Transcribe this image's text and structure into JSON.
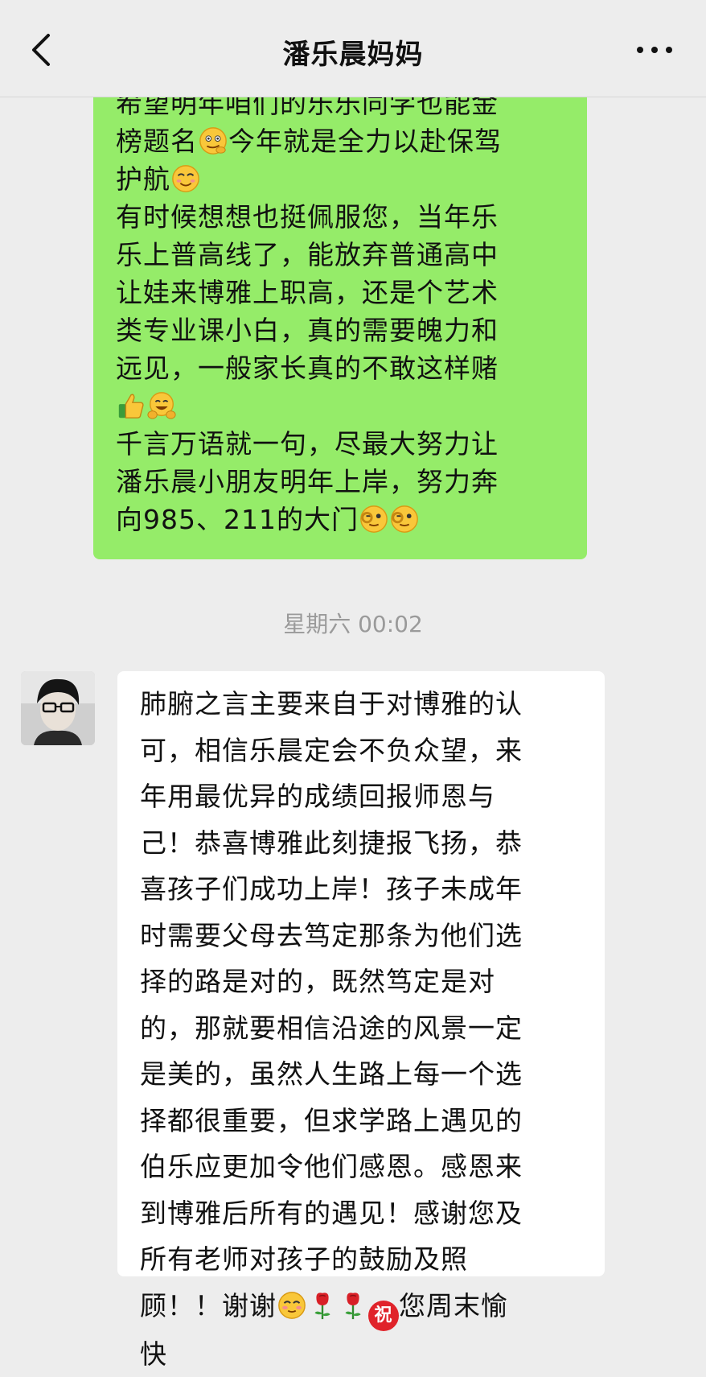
{
  "header": {
    "title": "潘乐晨妈妈",
    "back_icon": "chevron-left-icon",
    "more_icon": "ellipsis-icon"
  },
  "colors": {
    "background": "#ededed",
    "outgoing_bubble": "#95ec69",
    "incoming_bubble": "#ffffff",
    "timestamp_text": "#9a9a9a"
  },
  "outgoing_message": {
    "line1": "希望明年咱们的乐乐同学也能金",
    "line2a": "榜题名",
    "line2b": "今年就是全力以赴保驾",
    "line3": "护航",
    "line4": "有时候想想也挺佩服您，当年乐",
    "line5": "乐上普高线了，能放弃普通高中",
    "line6": "让娃来博雅上职高，还是个艺术",
    "line7": "类专业课小白，真的需要魄力和",
    "line8": "远见，一般家长真的不敢这样赌",
    "line10": "千言万语就一句，尽最大努力让",
    "line11": "潘乐晨小朋友明年上岸，努力奔",
    "line12": "向985、211的大门",
    "emojis": [
      "smirk-hand-chin",
      "smiling",
      "thumbs-up",
      "grinning-hands",
      "wink-ok",
      "wink-ok"
    ]
  },
  "timestamp": "星期六 00:02",
  "incoming_message": {
    "line1": "肺腑之言主要来自于对博雅的认",
    "line2": "可，相信乐晨定会不负众望，来",
    "line3": "年用最优异的成绩回报师恩与",
    "line4": "己！恭喜博雅此刻捷报飞扬，恭",
    "line5": "喜孩子们成功上岸！孩子未成年",
    "line6": "时需要父母去笃定那条为他们选",
    "line7": "择的路是对的，既然笃定是对",
    "line8": "的，那就要相信沿途的风景一定",
    "line9": "是美的，虽然人生路上每一个选",
    "line10": "择都很重要，但求学路上遇见的",
    "line11": "伯乐应更加令他们感恩。感恩来",
    "line12": "到博雅后所有的遇见！感谢您及",
    "line13": "所有老师对孩子的鼓励及照",
    "line14a": "顾！！谢谢",
    "zhu_char": "祝",
    "line14b": "您周末愉",
    "line15": "快",
    "emojis": [
      "blush",
      "rose",
      "rose",
      "zhu-badge"
    ]
  }
}
